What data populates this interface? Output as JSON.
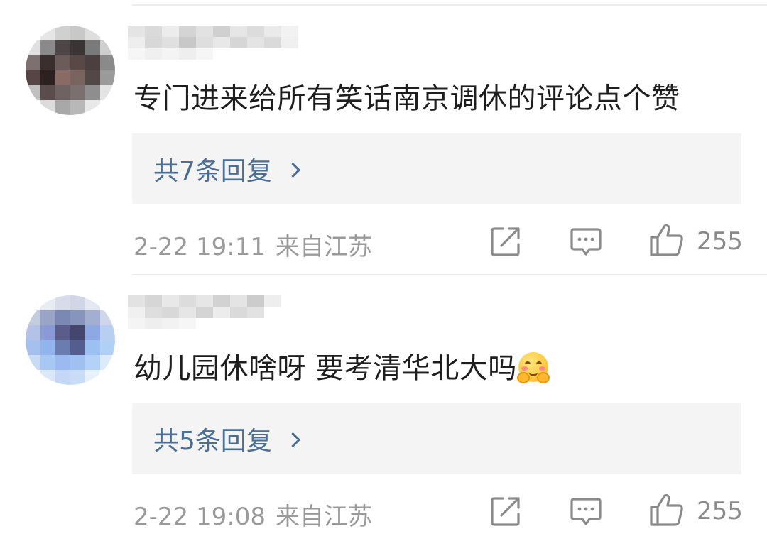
{
  "comments": [
    {
      "text": "专门进来给所有笑话南京调休的评论点个赞",
      "emoji": "",
      "replies_label": "共7条回复",
      "time": "2-22 19:11",
      "location": "来自江苏",
      "like_count": "255",
      "avatar_icon": "pixelated-avatar",
      "username_icon": "pixelated-username"
    },
    {
      "text": "幼儿园休啥呀 要考清华北大吗",
      "emoji": "blushing-hug-emoji",
      "replies_label": "共5条回复",
      "time": "2-22 19:08",
      "location": "来自江苏",
      "like_count": "255",
      "avatar_icon": "pixelated-avatar",
      "username_icon": "pixelated-username"
    }
  ],
  "icons": {
    "share": "share-icon",
    "comment": "comment-icon",
    "like": "thumbs-up-icon",
    "chevron": "chevron-right-icon"
  },
  "colors": {
    "link": "#4a6e95",
    "meta": "#9a9a9a",
    "text": "#1e1e1e",
    "reply_bg": "#f4f4f4"
  }
}
